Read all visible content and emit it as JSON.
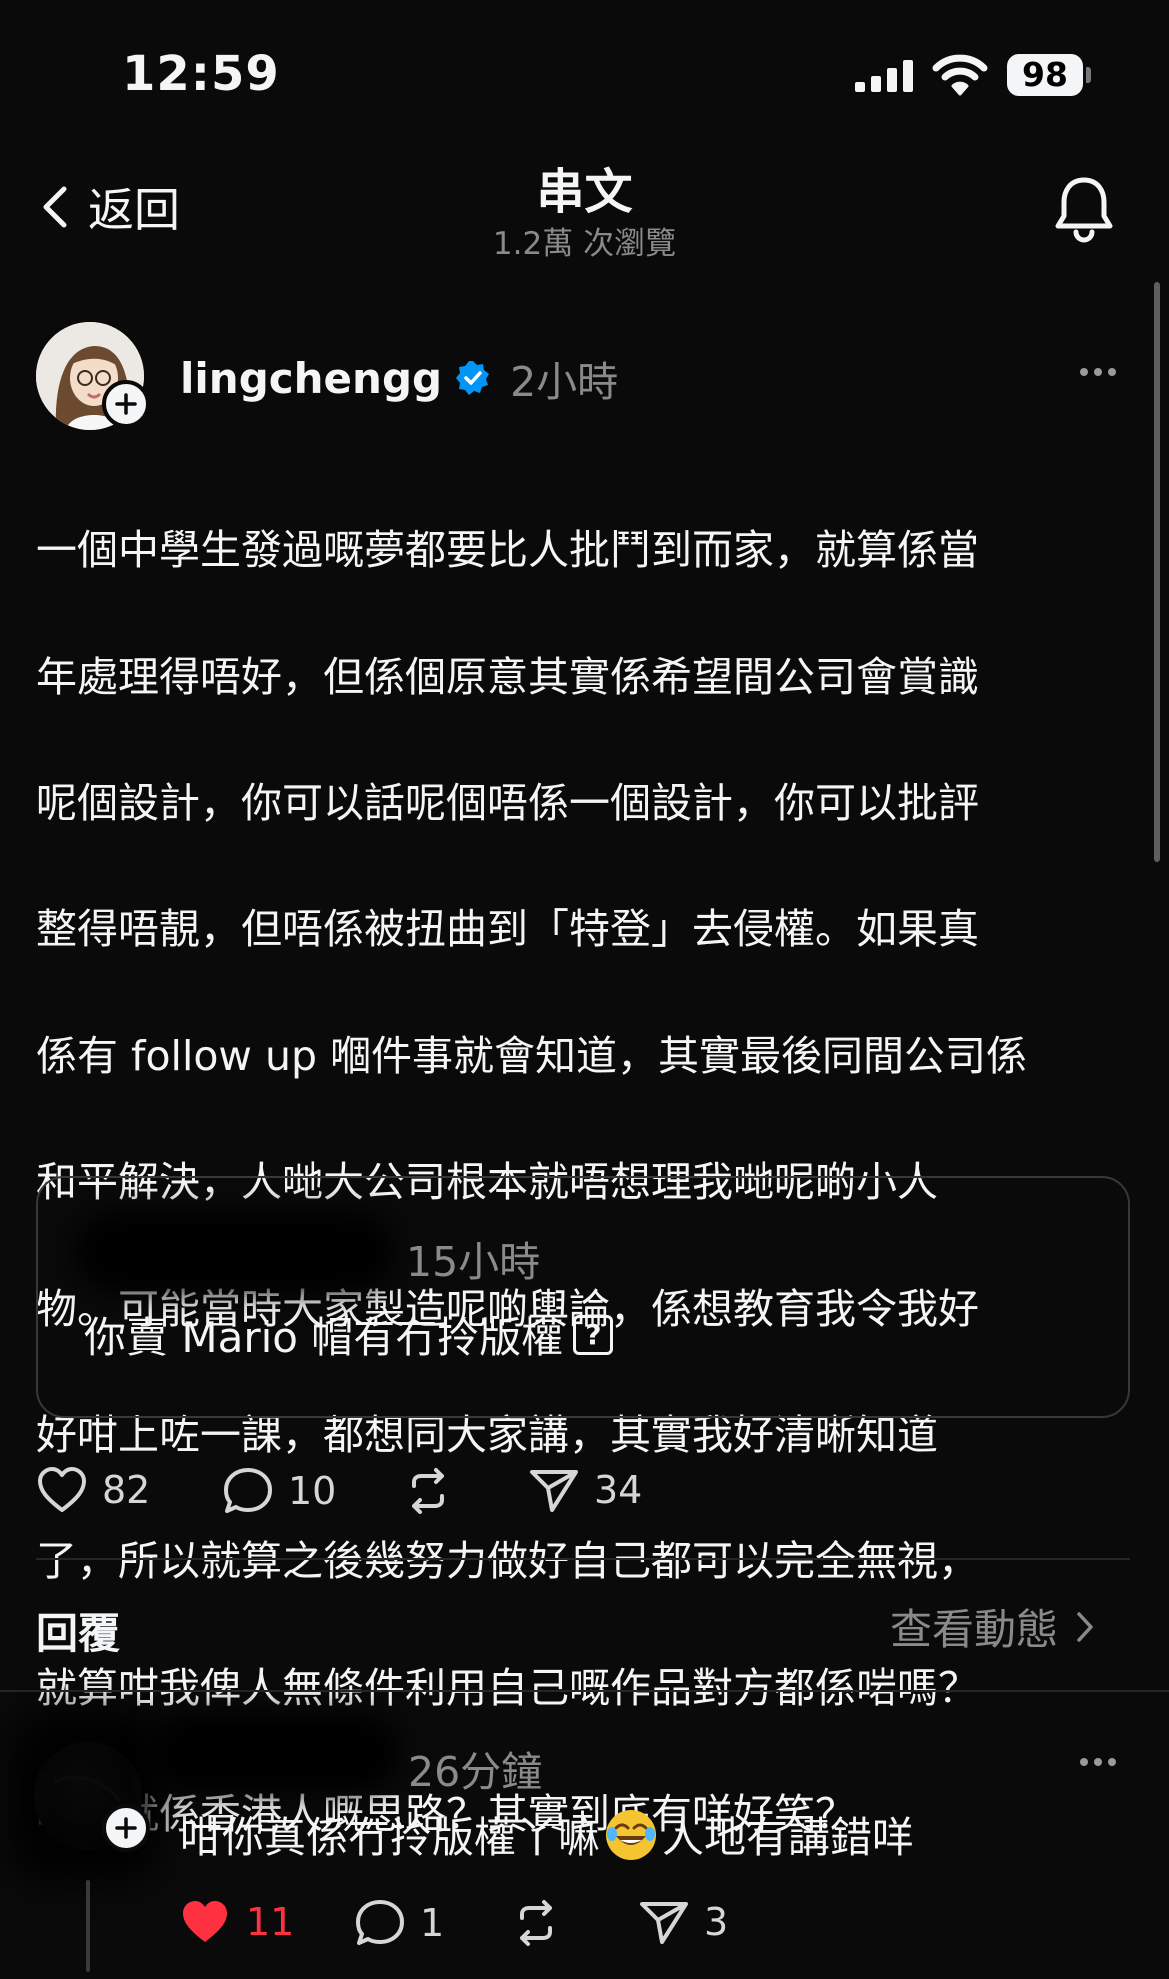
{
  "status_bar": {
    "time": "12:59",
    "battery": "98"
  },
  "header": {
    "back_label": "返回",
    "title": "串文",
    "views": "1.2萬 次瀏覽"
  },
  "post": {
    "username": "lingchengg",
    "time": "2小時",
    "lines": [
      "一個中學生發過嘅夢都要比人批鬥到而家，就算係當",
      "年處理得唔好，但係個原意其實係希望間公司會賞識",
      "呢個設計，你可以話呢個唔係一個設計，你可以批評",
      "整得唔靚，但唔係被扭曲到「特登」去侵權。如果真",
      "係有 follow up 嗰件事就會知道，其實最後同間公司係",
      "和平解決，人哋大公司根本就唔想理我哋呢啲小人",
      "物。可能當時大家製造呢啲輿論，係想教育我令我好",
      "好咁上咗一課，都想同大家講，其實我好清晰知道",
      "了，所以就算之後幾努力做好自己都可以完全無視，",
      "就算咁我俾人無條件利用自己嘅作品對方都係啱嗎？",
      "呢個就係香港人嘅思路？其實到底有咩好笑？"
    ],
    "quote": {
      "time": "15小時",
      "text": "你賣 Mario 帽有冇拎版權"
    },
    "actions": {
      "likes": "82",
      "comments": "10",
      "shares": "34"
    },
    "icons": [
      "heart-icon",
      "comment-icon",
      "repost-icon",
      "share-icon"
    ]
  },
  "replies_section": {
    "label": "回覆",
    "activity_link": "查看動態"
  },
  "reply": {
    "time": "26分鐘",
    "text_before": "咁你真係冇拎版權丫嘛",
    "text_after": "人地有講錯咩",
    "likes": "11",
    "comments": "1",
    "shares": "3"
  },
  "colors": {
    "background": "#0a0a0a",
    "text": "#f3f5f7",
    "secondary": "#8a8a8a",
    "verified": "#0095f6",
    "liked": "#ff3040"
  }
}
